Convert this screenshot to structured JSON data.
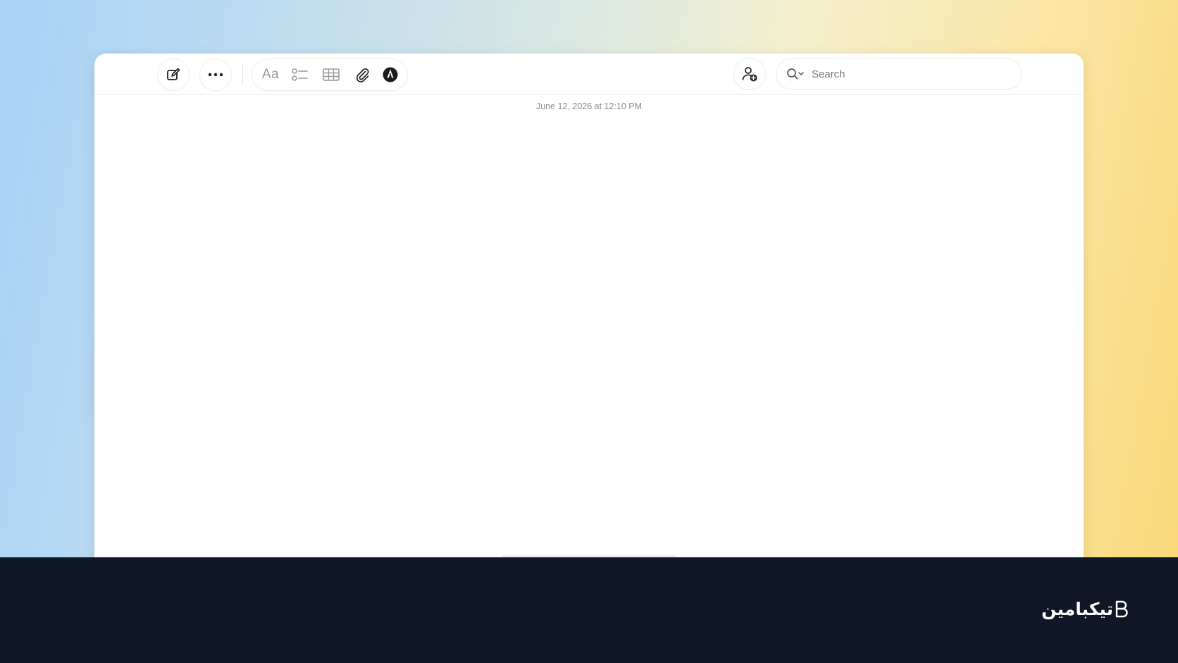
{
  "toolbar": {
    "new_note_icon": "compose-icon",
    "more_icon": "ellipsis-icon",
    "format_label": "Aa",
    "checklist_icon": "checklist-icon",
    "table_icon": "table-icon",
    "attachment_icon": "paperclip-icon",
    "markup_icon": "markup-pen-icon",
    "collaborate_icon": "collaborate-icon"
  },
  "search": {
    "placeholder": "Search",
    "value": ""
  },
  "note": {
    "date": "June 12, 2026 at 12:10 PM",
    "body": ""
  },
  "footer": {
    "brand_text": "تیکبامین"
  },
  "colors": {
    "footer_bg": "#101828",
    "window_bg": "#ffffff",
    "icon_dark": "#1c1c1e",
    "icon_muted": "#9a9a9a"
  }
}
